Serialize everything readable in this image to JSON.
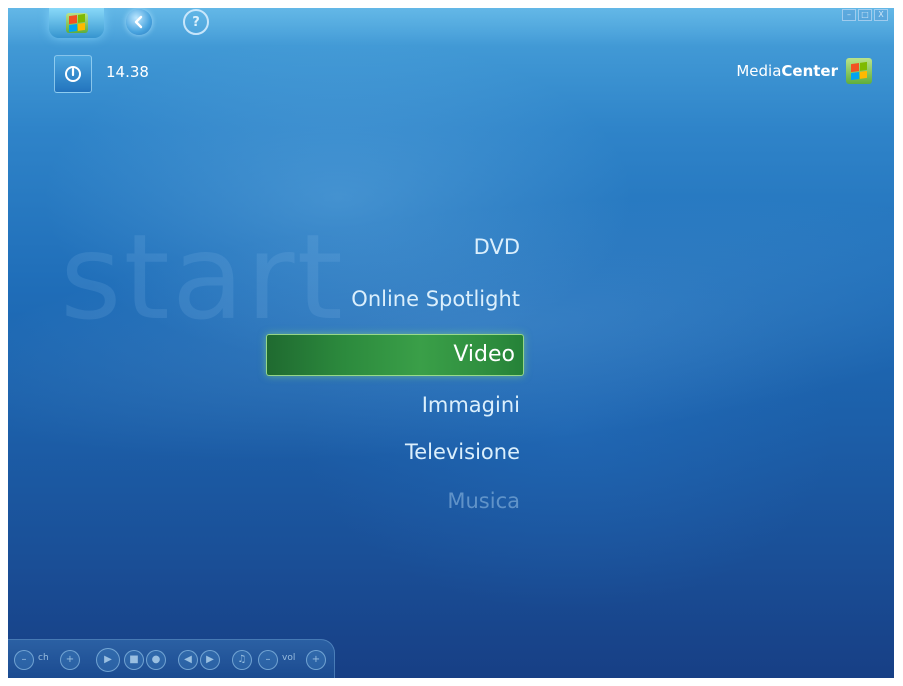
{
  "top_bar": {
    "start_button_icon": "windows-flag-icon",
    "back_button_icon": "back-arrow-icon",
    "help_button_icon": "help-icon",
    "help_glyph": "?",
    "window_controls": [
      "–",
      "□",
      "X"
    ]
  },
  "status": {
    "power_icon": "power-icon",
    "time": "14.38"
  },
  "brand": {
    "light": "Media",
    "bold": "Center",
    "logo_icon": "windows-flag-icon"
  },
  "background_word": "start",
  "menu": {
    "items": [
      {
        "label": "DVD",
        "state": "normal"
      },
      {
        "label": "Online Spotlight",
        "state": "normal"
      },
      {
        "label": "Video",
        "state": "selected"
      },
      {
        "label": "Immagini",
        "state": "normal"
      },
      {
        "label": "Televisione",
        "state": "normal"
      },
      {
        "label": "Musica",
        "state": "faded"
      }
    ]
  },
  "transport": {
    "ch_label": "ch",
    "vol_label": "vol",
    "minus": "–",
    "plus": "+"
  },
  "colors": {
    "background": "#1f6db8",
    "selection": "#2c8a3d",
    "text": "#ffffff"
  }
}
